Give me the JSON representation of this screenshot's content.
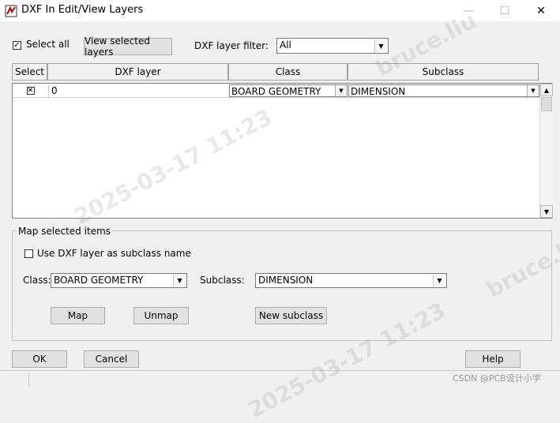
{
  "window": {
    "title": "DXF In Edit/View Layers",
    "controls": {
      "minimize": "—",
      "maximize": "☐",
      "close": "✕"
    }
  },
  "toolbar": {
    "select_all_label": "Select all",
    "select_all_checked": true,
    "view_selected_label": "View selected layers",
    "filter_label": "DXF layer filter:",
    "filter_value": "All"
  },
  "table": {
    "headers": [
      "Select",
      "DXF layer",
      "Class",
      "Subclass"
    ],
    "rows": [
      {
        "selected": true,
        "layer": "0",
        "class": "BOARD GEOMETRY",
        "subclass": "DIMENSION"
      }
    ]
  },
  "map_group": {
    "label": "Map selected items",
    "use_dxf_label": "Use DXF layer as subclass name",
    "use_dxf_checked": false,
    "class_label": "Class:",
    "class_value": "BOARD GEOMETRY",
    "subclass_label": "Subclass:",
    "subclass_value": "DIMENSION",
    "map_label": "Map",
    "unmap_label": "Unmap",
    "new_subclass_label": "New subclass"
  },
  "footer": {
    "ok_label": "OK",
    "cancel_label": "Cancel",
    "help_label": "Help"
  },
  "watermark": {
    "brand": "bruce.liu",
    "date": "2025-03-17 11:23",
    "credit": "CSDN @PCB设计小学"
  }
}
